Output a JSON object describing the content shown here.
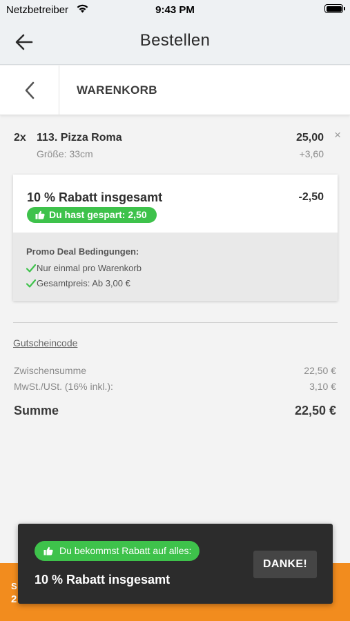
{
  "status_bar": {
    "carrier": "Netzbetreiber",
    "time": "9:43 PM"
  },
  "nav": {
    "title": "Bestellen",
    "back_icon": "arrow-left-icon"
  },
  "cart": {
    "title": "WARENKORB",
    "back_icon": "chevron-left-icon"
  },
  "item": {
    "quantity": "2x",
    "name": "113. Pizza Roma",
    "size": "Größe: 33cm",
    "price": "25,00",
    "extra_price": "+3,60",
    "remove_icon": "×"
  },
  "promo": {
    "title": "10 % Rabatt insgesamt",
    "amount": "-2,50",
    "saved_label": "Du hast gespart: 2,50",
    "conditions_title": "Promo Deal Bedingungen:",
    "conditions": [
      "Nur einmal pro Warenkorb",
      "Gesamtpreis: Ab 3,00 €"
    ]
  },
  "summary": {
    "voucher_label": "Gutscheincode",
    "subtotal_label": "Zwischensumme",
    "subtotal_value": "22,50 €",
    "tax_label": "MwSt./USt. (16% inkl.):",
    "tax_value": "3,10 €",
    "total_label": "Summe",
    "total_value": "22,50 €"
  },
  "bottom_bar": {
    "line1": "S",
    "line2": "2"
  },
  "toast": {
    "badge_label": "Du bekommst Rabatt auf alles:",
    "title": "10 % Rabatt insgesamt",
    "button_label": "DANKE!"
  },
  "colors": {
    "accent_green": "#3ec24b",
    "bar_orange": "#f28c1e",
    "toast_bg": "#2c2c2c"
  }
}
